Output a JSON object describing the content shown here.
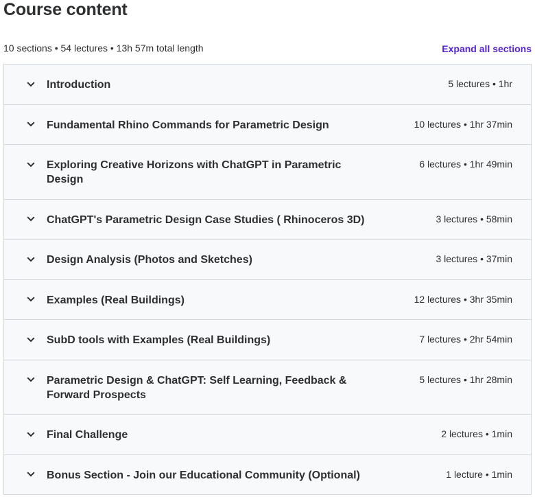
{
  "header": {
    "title": "Course content",
    "summary": "10 sections • 54 lectures • 13h 57m total length",
    "expand_label": "Expand all sections"
  },
  "colors": {
    "link": "#5624d0",
    "section_bg": "#f7f9fa",
    "border": "#d1d7dc",
    "text": "#2d2f31"
  },
  "sections": [
    {
      "title": "Introduction",
      "meta": "5 lectures • 1hr",
      "icon": "chevron-down-icon"
    },
    {
      "title": "Fundamental Rhino Commands for Parametric Design",
      "meta": "10 lectures • 1hr 37min",
      "icon": "chevron-down-icon"
    },
    {
      "title": "Exploring Creative Horizons with ChatGPT in Parametric Design",
      "meta": "6 lectures • 1hr 49min",
      "icon": "chevron-down-icon"
    },
    {
      "title": "ChatGPT's Parametric Design Case Studies ( Rhinoceros 3D)",
      "meta": "3 lectures • 58min",
      "icon": "chevron-down-icon"
    },
    {
      "title": "Design Analysis (Photos and Sketches)",
      "meta": "3 lectures • 37min",
      "icon": "chevron-down-icon"
    },
    {
      "title": "Examples (Real Buildings)",
      "meta": "12 lectures • 3hr 35min",
      "icon": "chevron-down-icon"
    },
    {
      "title": "SubD tools with Examples (Real Buildings)",
      "meta": "7 lectures • 2hr 54min",
      "icon": "chevron-down-icon"
    },
    {
      "title": "Parametric Design & ChatGPT: Self Learning, Feedback & Forward Prospects",
      "meta": "5 lectures • 1hr 28min",
      "icon": "chevron-down-icon"
    },
    {
      "title": "Final Challenge",
      "meta": "2 lectures • 1min",
      "icon": "chevron-down-icon"
    },
    {
      "title": "Bonus Section - Join our Educational Community (Optional)",
      "meta": "1 lecture • 1min",
      "icon": "chevron-down-icon"
    }
  ]
}
